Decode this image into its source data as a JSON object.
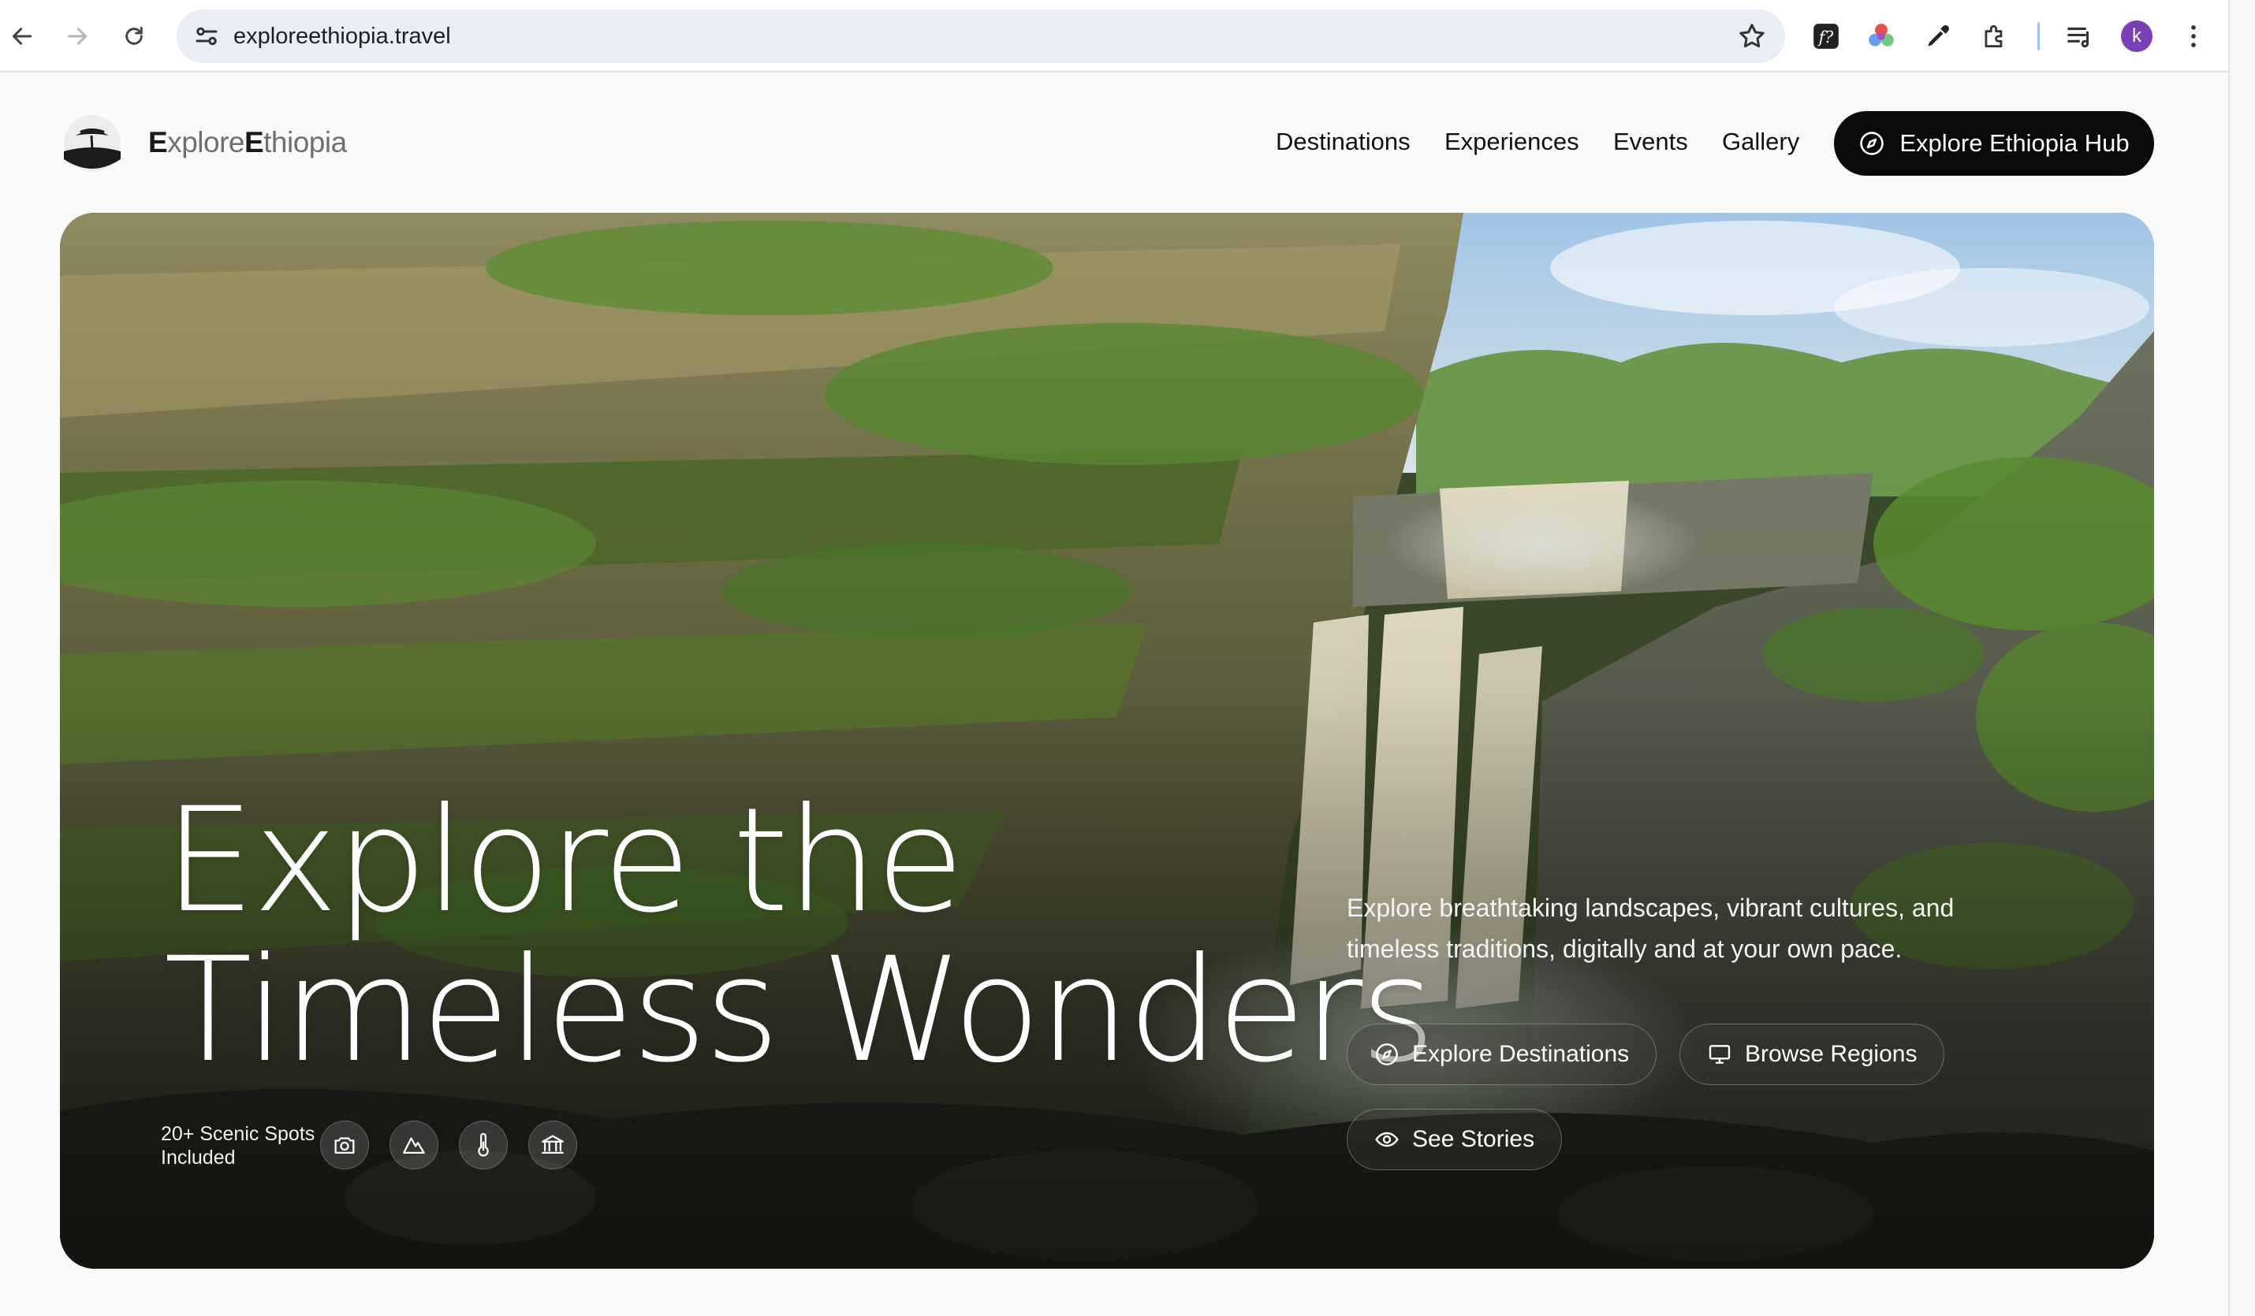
{
  "browser": {
    "url": "exploreethiopia.travel",
    "profile_initial": "k",
    "icons": [
      "back-icon",
      "forward-icon",
      "reload-icon",
      "site-settings-icon",
      "bookmark-star-icon",
      "fontface-extension-icon",
      "color-extension-icon",
      "eyedropper-extension-icon",
      "extensions-puzzle-icon",
      "reading-list-icon",
      "menu-kebab-icon"
    ]
  },
  "header": {
    "logo_first_letter": "E",
    "logo_part1": "xplore",
    "logo_second_letter": "E",
    "logo_part2": "thiopia",
    "nav": [
      "Destinations",
      "Experiences",
      "Events",
      "Gallery"
    ],
    "cta_label": "Explore Ethiopia Hub",
    "cta_icon": "compass-icon"
  },
  "hero": {
    "headline_line1": "Explore the",
    "headline_line2": "Timeless Wonders",
    "spots_label": "20+ Scenic Spots Included",
    "feature_icons": [
      "camera-icon",
      "mountain-icon",
      "thermometer-icon",
      "museum-icon"
    ],
    "tagline": "Explore breathtaking landscapes, vibrant cultures, and timeless traditions, digitally and at your own pace.",
    "buttons": {
      "explore_destinations": "Explore Destinations",
      "browse_regions": "Browse Regions",
      "see_stories": "See Stories"
    },
    "colors": {
      "cta_bg": "#0b0b0b",
      "pill_bg": "rgba(60,60,55,0.38)",
      "headline": "#ffffff"
    }
  }
}
